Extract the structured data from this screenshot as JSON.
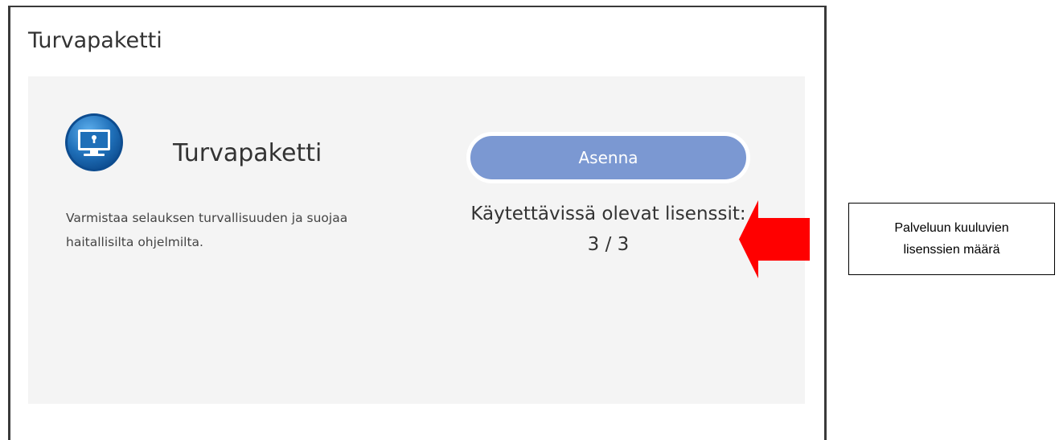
{
  "panel": {
    "title": "Turvapaketti"
  },
  "card": {
    "app_name": "Turvapaketti",
    "icon": "monitor-lock-icon",
    "description": "Varmistaa selauksen turvallisuuden ja suojaa haitallisilta ohjelmilta.",
    "install_label": "Asenna",
    "license_text": "Käytettävissä olevat lisenssit: 3 / 3"
  },
  "annotation": {
    "arrow_icon": "left-arrow-icon",
    "arrow_color": "#ff0000",
    "callout_text": "Palveluun kuuluvien lisenssien määrä"
  },
  "colors": {
    "button": "#7b98d2",
    "card_background": "#f4f4f4",
    "icon_blue": "#1f6fb8"
  }
}
